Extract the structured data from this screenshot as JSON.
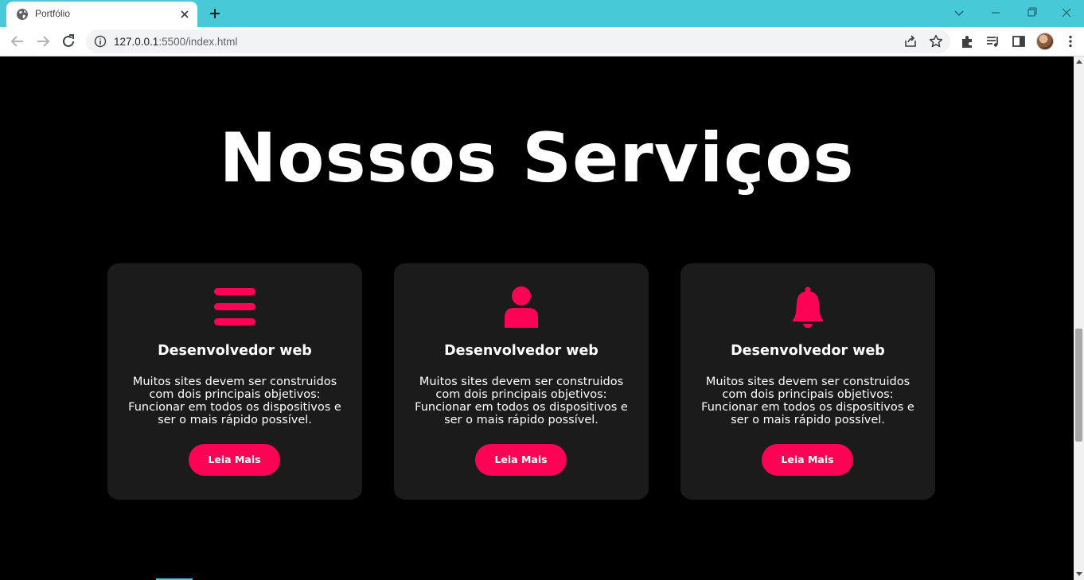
{
  "browser": {
    "tab_title": "Portfólio",
    "url_host": "127.0.0.1",
    "url_rest": ":5500/index.html",
    "accent_color": "#48c9d8"
  },
  "page": {
    "heading": "Nossos Serviços",
    "accent_color": "#fe0255",
    "background_color": "#000000",
    "card_color": "#1b1b1c",
    "cards": [
      {
        "icon": "bars-icon",
        "title": "Desenvolvedor web",
        "text": "Muitos sites devem ser construidos com dois principais objetivos: Funcionar em todos os dispositivos e ser o mais rápido possível.",
        "button": "Leia Mais"
      },
      {
        "icon": "user-icon",
        "title": "Desenvolvedor web",
        "text": "Muitos sites devem ser construidos com dois principais objetivos: Funcionar em todos os dispositivos e ser o mais rápido possível.",
        "button": "Leia Mais"
      },
      {
        "icon": "bell-icon",
        "title": "Desenvolvedor web",
        "text": "Muitos sites devem ser construidos com dois principais objetivos: Funcionar em todos os dispositivos e ser o mais rápido possível.",
        "button": "Leia Mais"
      }
    ]
  }
}
